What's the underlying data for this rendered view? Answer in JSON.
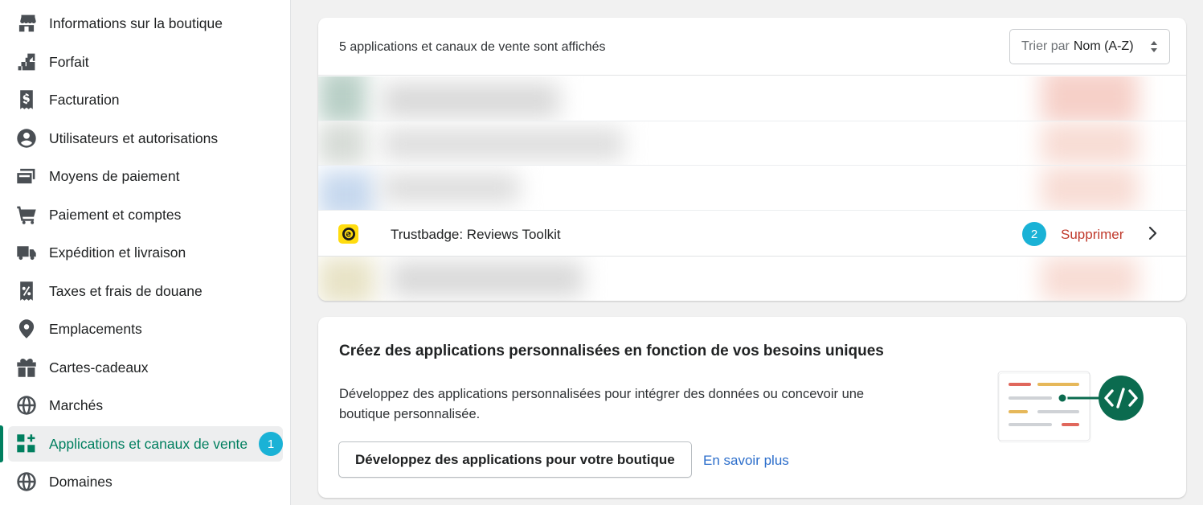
{
  "sidebar": {
    "items": [
      {
        "label": "Informations sur la boutique",
        "icon": "store-icon"
      },
      {
        "label": "Forfait",
        "icon": "plan-icon"
      },
      {
        "label": "Facturation",
        "icon": "billing-icon"
      },
      {
        "label": "Utilisateurs et autorisations",
        "icon": "user-icon"
      },
      {
        "label": "Moyens de paiement",
        "icon": "payment-card-icon"
      },
      {
        "label": "Paiement et comptes",
        "icon": "cart-icon"
      },
      {
        "label": "Expédition et livraison",
        "icon": "truck-icon"
      },
      {
        "label": "Taxes et frais de douane",
        "icon": "tax-receipt-icon"
      },
      {
        "label": "Emplacements",
        "icon": "location-pin-icon"
      },
      {
        "label": "Cartes-cadeaux",
        "icon": "gift-icon"
      },
      {
        "label": "Marchés",
        "icon": "globe-icon"
      },
      {
        "label": "Applications et canaux de vente",
        "icon": "apps-icon",
        "badge": "1",
        "active": true
      },
      {
        "label": "Domaines",
        "icon": "domains-globe-icon"
      }
    ]
  },
  "apps": {
    "count_text": "5 applications et canaux de vente sont affichés",
    "sort_prefix": "Trier par",
    "sort_value": "Nom (A-Z)",
    "visible_app": {
      "name": "Trustbadge: Reviews Toolkit",
      "badge": "2",
      "action": "Supprimer"
    }
  },
  "custom_apps": {
    "title": "Créez des applications personnalisées en fonction de vos besoins uniques",
    "description": "Développez des applications personnalisées pour intégrer des données ou concevoir une boutique personnalisée.",
    "button": "Développez des applications pour votre boutique",
    "link": "En savoir plus"
  },
  "colors": {
    "accent_green": "#007f5f",
    "badge_blue": "#1ab2d6",
    "delete_red": "#c0392b",
    "link_blue": "#2c6ecb"
  }
}
